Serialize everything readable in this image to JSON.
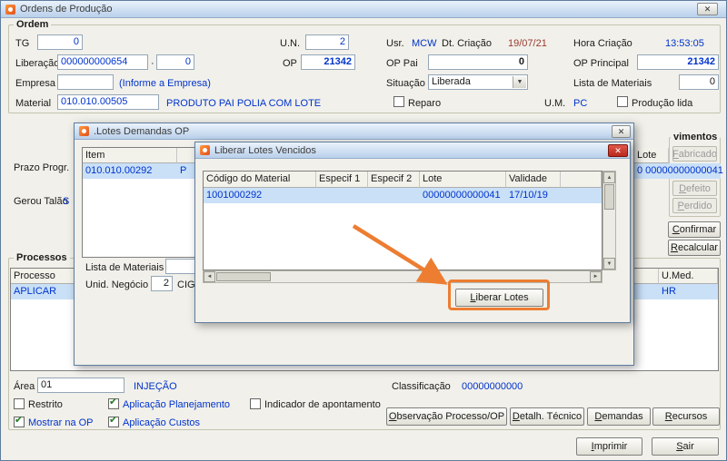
{
  "window": {
    "title": "Ordens de Produção"
  },
  "icons": {
    "close": "✕",
    "chevron_down": "▼",
    "check": "✔",
    "scroll_up": "▲",
    "scroll_down": "▼",
    "scroll_left": "◄",
    "scroll_right": "►"
  },
  "colors": {
    "value_blue": "#0033cc",
    "date_red": "#9c3a2e",
    "selection_bg": "#c9e0f7",
    "annotation": "#ed7d31",
    "danger_close": "#c0392b"
  },
  "ordem": {
    "group_label": "Ordem",
    "tg_label": "TG",
    "tg_value": "0",
    "un_label": "U.N.",
    "un_value": "2",
    "usr_label": "Usr.",
    "usr_value": "MCW",
    "dtcriacao_label": "Dt. Criação",
    "dtcriacao_value": "19/07/21",
    "horacriacao_label": "Hora Criação",
    "horacriacao_value": "13:53:05",
    "liberacao_label": "Liberação",
    "liberacao_value": "000000000654",
    "liberacao_sep": "·",
    "liberacao_seq": "0",
    "op_label": "OP",
    "op_value": "21342",
    "oppai_label": "OP Pai",
    "oppai_value": "0",
    "opprincipal_label": "OP Principal",
    "opprincipal_value": "21342",
    "empresa_label": "Empresa",
    "empresa_value": "",
    "empresa_link": "(Informe a Empresa)",
    "situacao_label": "Situação",
    "situacao_value": "Liberada",
    "listamat_label": "Lista de Materiais",
    "listamat_value": "0",
    "material_label": "Material",
    "material_value": "010.010.00505",
    "material_desc": "PRODUTO PAI POLIA COM LOTE",
    "reparo_label": "Reparo",
    "um_label": "U.M.",
    "um_value": "PC",
    "producaolida_label": "Produção lida"
  },
  "background": {
    "prazo_label": "Prazo Progr.",
    "geroutalao_label": "Gerou Talão",
    "geroutalao_value": "S",
    "lote_header": "Lote",
    "lote_value": "0 00000000000041",
    "movimentos_label": "vimentos",
    "btn_fabricado": "Fabricado",
    "btn_defeito": "Defeito",
    "btn_perdido": "Perdido",
    "btn_confirmar": "Confirmar",
    "btn_recalcular": "Recalcular"
  },
  "processos": {
    "group_label": "Processos",
    "col_processo": "Processo",
    "col_umed": "U.Med.",
    "row_processo": "APLICAR",
    "row_umed": "HR",
    "area_label": "Área",
    "area_value": "01",
    "area_desc": "INJEÇÃO",
    "classificacao_label": "Classificação",
    "classificacao_value": "00000000000",
    "chk_restrito": "Restrito",
    "chk_aplic_planejamento": "Aplicação Planejamento",
    "chk_indicador": "Indicador de apontamento",
    "chk_mostrar_op": "Mostrar na OP",
    "chk_aplic_custos": "Aplicação Custos",
    "btn_observacao": "Observação Processo/OP",
    "btn_detalhe": "Detalh. Técnico",
    "btn_demandas": "Demandas",
    "btn_recursos": "Recursos",
    "btn_imprimir": "Imprimir",
    "btn_sair": "Sair"
  },
  "state": {
    "reparo": false,
    "producao_lida": false,
    "restrito": false,
    "aplicacao_planejamento": true,
    "indicador_apontamento": false,
    "mostrar_na_op": true,
    "aplicacao_custos": true
  },
  "dialog_lotes": {
    "title": ".Lotes Demandas OP",
    "col_item": "Item",
    "row_item": "010.010.00292",
    "row_desc": "P",
    "listamat_label": "Lista de Materiais",
    "unidneg_label": "Unid. Negócio",
    "unidneg_value": "2",
    "unidneg_desc": "CIGA"
  },
  "dialog_liberar": {
    "title": "Liberar Lotes Vencidos",
    "columns": [
      "Código do Material",
      "Especif 1",
      "Especif 2",
      "Lote",
      "Validade"
    ],
    "row": {
      "codigo": "1001000292",
      "especif1": "",
      "especif2": "",
      "lote": "00000000000041",
      "validade": "17/10/19"
    },
    "btn_liberar": "Liberar Lotes"
  }
}
